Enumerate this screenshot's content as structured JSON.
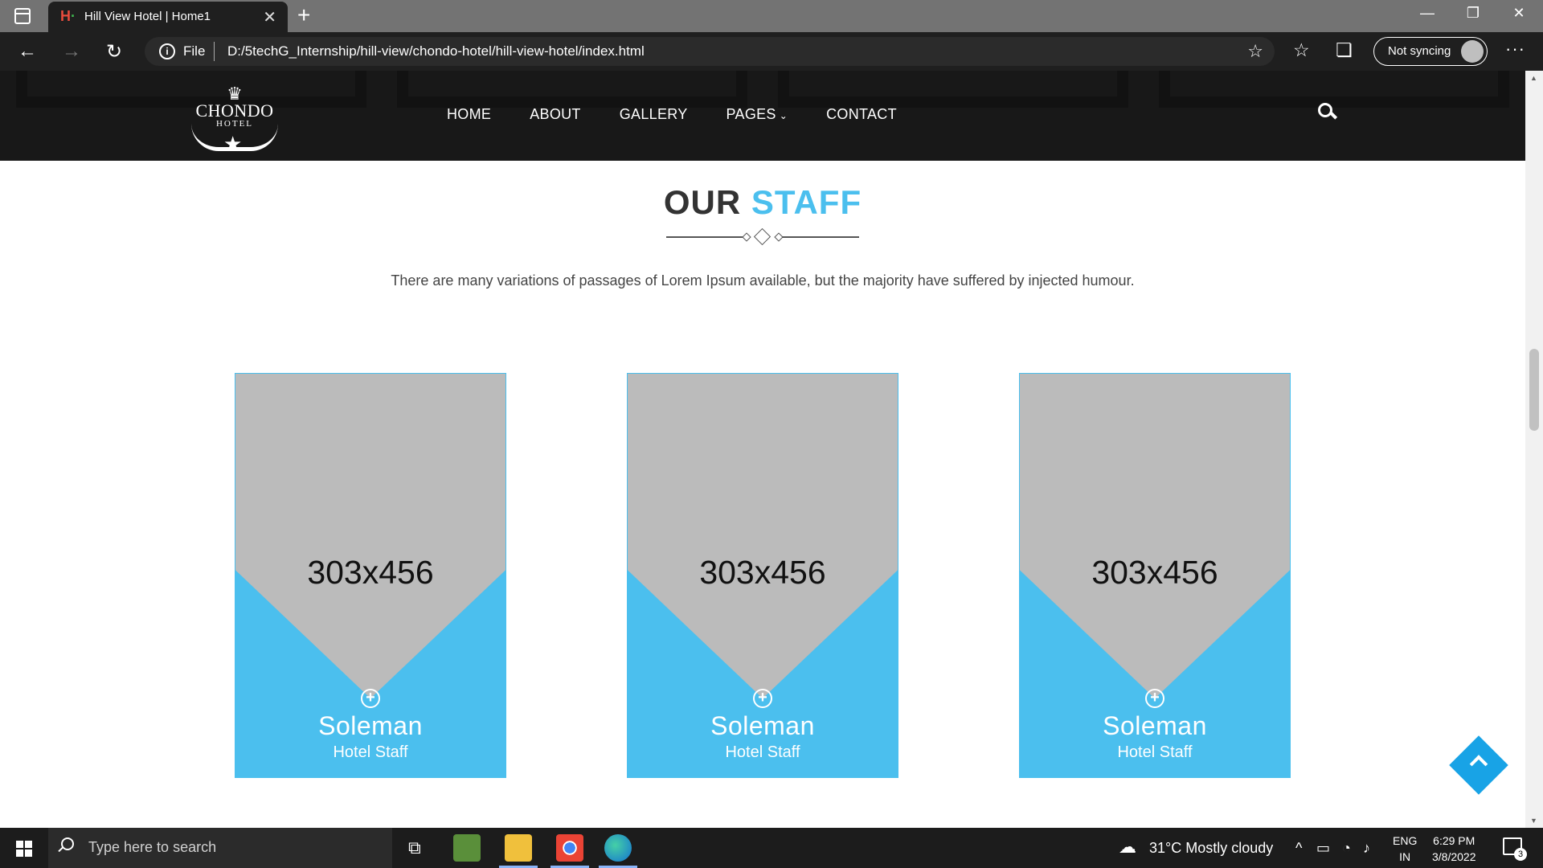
{
  "browser": {
    "tab_title": "Hill View Hotel | Home1",
    "file_label": "File",
    "url": "D:/5techG_Internship/hill-view/chondo-hotel/hill-view-hotel/index.html",
    "sync_label": "Not syncing"
  },
  "site": {
    "logo_name": "CHONDO",
    "logo_sub": "HOTEL",
    "nav": [
      "HOME",
      "ABOUT",
      "GALLERY",
      "PAGES",
      "CONTACT"
    ],
    "section_title_main": "OUR",
    "section_title_accent": "STAFF",
    "intro": "There are many variations of passages of Lorem Ipsum available, but the majority have suffered by injected humour.",
    "accent_color": "#4bbfee",
    "staff": [
      {
        "placeholder": "303x456",
        "name": "Soleman",
        "role": "Hotel Staff"
      },
      {
        "placeholder": "303x456",
        "name": "Soleman",
        "role": "Hotel Staff"
      },
      {
        "placeholder": "303x456",
        "name": "Soleman",
        "role": "Hotel Staff"
      }
    ]
  },
  "taskbar": {
    "search_placeholder": "Type here to search",
    "weather": "31°C  Mostly cloudy",
    "lang_top": "ENG",
    "lang_bottom": "IN",
    "time": "6:29 PM",
    "date": "3/8/2022",
    "notification_count": "3"
  }
}
